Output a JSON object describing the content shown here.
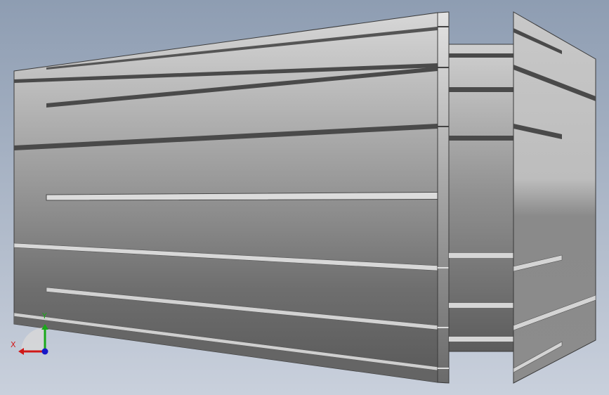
{
  "viewport": {
    "background_top": "#8e9db2",
    "background_bottom": "#c9d0dc"
  },
  "triad": {
    "x_label": "X",
    "y_label": "Y",
    "x_color": "#d01818",
    "y_color": "#18a818",
    "z_color": "#1818c8"
  }
}
